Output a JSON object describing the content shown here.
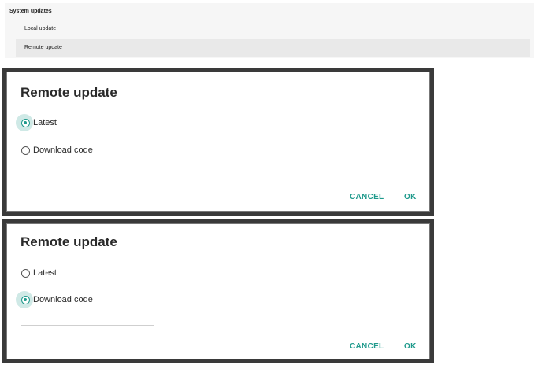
{
  "settings": {
    "header": "System updates",
    "items": [
      "Local update",
      "Remote update"
    ]
  },
  "dialogs": [
    {
      "title": "Remote update",
      "options": [
        {
          "label": "Latest",
          "selected": true
        },
        {
          "label": "Download code",
          "selected": false
        }
      ],
      "cancel_label": "CANCEL",
      "ok_label": "OK"
    },
    {
      "title": "Remote update",
      "options": [
        {
          "label": "Latest",
          "selected": false
        },
        {
          "label": "Download code",
          "selected": true
        }
      ],
      "cancel_label": "CANCEL",
      "ok_label": "OK"
    }
  ],
  "colors": {
    "accent": "#1f9a8c",
    "selected_halo": "#cfe9e6",
    "dialog_border": "#3a3a3a",
    "panel_background": "#f6f6f6"
  }
}
